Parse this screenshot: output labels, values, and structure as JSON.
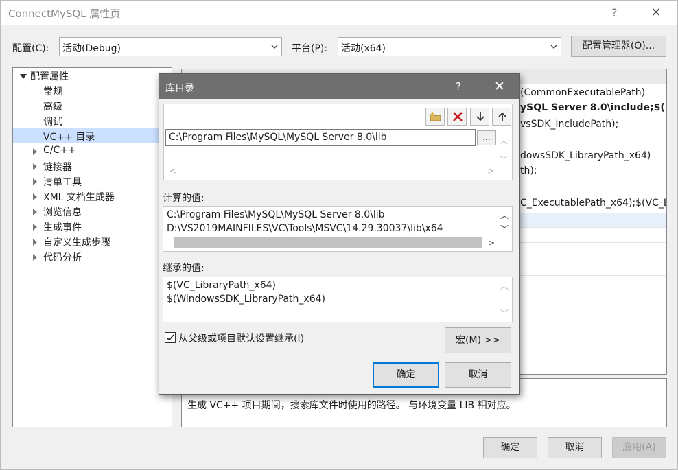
{
  "window": {
    "title": "ConnectMySQL 属性页",
    "help_label": "?",
    "close_label": "✕"
  },
  "config": {
    "config_label": "配置(C):",
    "config_value": "活动(Debug)",
    "platform_label": "平台(P):",
    "platform_value": "活动(x64)",
    "manager_button": "配置管理器(O)..."
  },
  "tree": {
    "root": "配置属性",
    "children": [
      "常规",
      "高级",
      "调试",
      "VC++ 目录"
    ],
    "groups": [
      "C/C++",
      "链接器",
      "清单工具",
      "XML 文档生成器",
      "浏览信息",
      "生成事件",
      "自定义生成步骤",
      "代码分析"
    ]
  },
  "props": {
    "values": [
      "(CommonExecutablePath)",
      "ySQL Server 8.0\\include;$(In",
      "vsSDK_IncludePath);",
      "dowsSDK_LibraryPath_x64)",
      "th);",
      "C_ExecutablePath_x64);$(VC_L"
    ]
  },
  "description": {
    "text": "生成 VC++ 项目期间，搜索库文件时使用的路径。 与环境变量 LIB 相对应。"
  },
  "footer": {
    "ok": "确定",
    "cancel": "取消",
    "apply": "应用(A)"
  },
  "dialog": {
    "title": "库目录",
    "help_label": "?",
    "close_label": "✕",
    "entry_value": "C:\\Program Files\\MySQL\\MySQL Server 8.0\\lib",
    "ellipsis_label": "...",
    "computed_label": "计算的值:",
    "computed_lines": [
      "C:\\Program Files\\MySQL\\MySQL Server 8.0\\lib",
      "D:\\VS2019MAINFILES\\VC\\Tools\\MSVC\\14.29.30037\\lib\\x64"
    ],
    "inherited_label": "继承的值:",
    "inherited_lines": [
      "$(VC_LibraryPath_x64)",
      "$(WindowsSDK_LibraryPath_x64)"
    ],
    "inherit_checkbox_label": "从父级或项目默认设置继承(I)",
    "inherit_checked": true,
    "macro_button": "宏(M) >>",
    "ok": "确定",
    "cancel": "取消"
  }
}
